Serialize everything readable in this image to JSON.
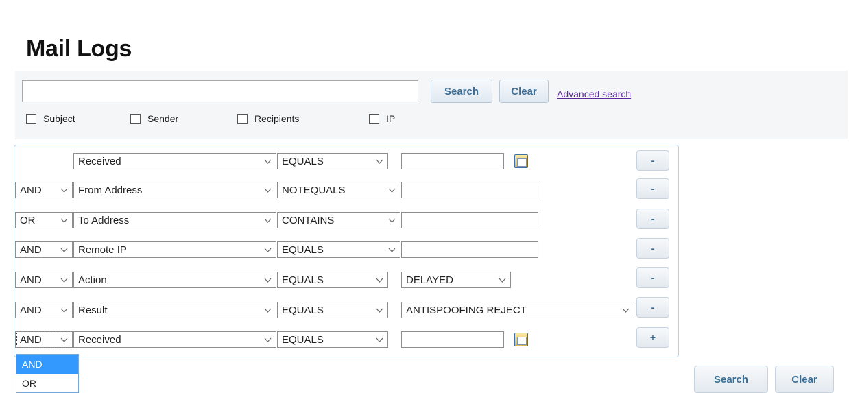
{
  "page": {
    "title": "Mail Logs"
  },
  "search": {
    "query_value": "",
    "search_label": "Search",
    "clear_label": "Clear",
    "advanced_label": "Advanced search",
    "checkboxes": [
      {
        "label": "Subject",
        "checked": false
      },
      {
        "label": "Sender",
        "checked": false
      },
      {
        "label": "Recipients",
        "checked": false
      },
      {
        "label": "IP",
        "checked": false
      }
    ]
  },
  "filters": [
    {
      "logic": "",
      "field": "Received",
      "op": "EQUALS",
      "value_type": "date",
      "value": "",
      "button": "-"
    },
    {
      "logic": "AND",
      "field": "From Address",
      "op": "NOTEQUALS",
      "value_type": "text",
      "value": "",
      "button": "-"
    },
    {
      "logic": "OR",
      "field": "To Address",
      "op": "CONTAINS",
      "value_type": "text",
      "value": "",
      "button": "-"
    },
    {
      "logic": "AND",
      "field": "Remote IP",
      "op": "EQUALS",
      "value_type": "text",
      "value": "",
      "button": "-"
    },
    {
      "logic": "AND",
      "field": "Action",
      "op": "EQUALS",
      "value_type": "select",
      "value": "DELAYED",
      "button": "-"
    },
    {
      "logic": "AND",
      "field": "Result",
      "op": "EQUALS",
      "value_type": "select",
      "value": "ANTISPOOFING REJECT",
      "button": "-"
    },
    {
      "logic": "AND",
      "field": "Received",
      "op": "EQUALS",
      "value_type": "date",
      "value": "",
      "button": "+"
    }
  ],
  "logic_dropdown": {
    "options": [
      "AND",
      "OR"
    ],
    "highlighted": "AND"
  },
  "footer": {
    "search_label": "Search",
    "clear_label": "Clear"
  },
  "colors": {
    "accent_text": "#3c6e95",
    "dropdown_highlight": "#3399ff",
    "link": "#5b2a9b"
  }
}
